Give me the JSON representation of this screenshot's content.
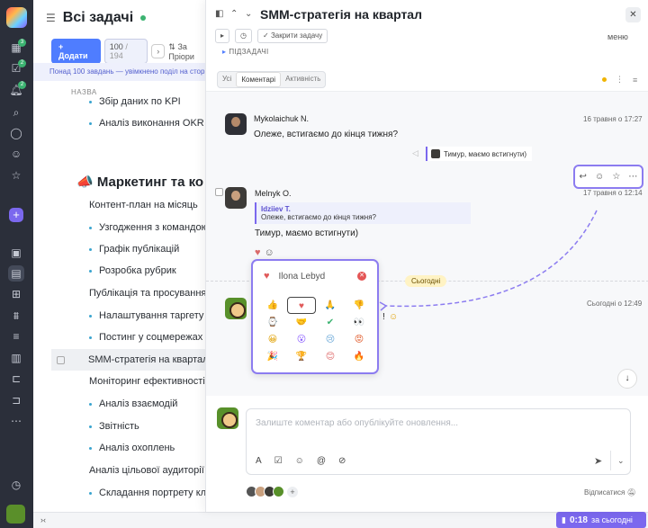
{
  "rail": {
    "badges": [
      "3",
      "2",
      "2"
    ]
  },
  "list": {
    "title": "Всі задачі",
    "add_label": "Додати",
    "pager_current": "100",
    "pager_total": "/ 194",
    "sort_label": "За Пріори",
    "notice": "Понад 100 завдань — увімкнено поділ на сторін",
    "column_name": "НАЗВА",
    "rows_top": [
      "Збір даних по KPI",
      "Аналіз виконання OKR"
    ],
    "section": "Маркетинг та ко",
    "rows": [
      {
        "text": "Контент-план на місяць",
        "bullet": false
      },
      {
        "text": "Узгодження з командою",
        "bullet": true
      },
      {
        "text": "Графік публікацій",
        "bullet": true
      },
      {
        "text": "Розробка рубрик",
        "bullet": true
      },
      {
        "text": "Публікація та просування",
        "bullet": false
      },
      {
        "text": "Налаштування таргету",
        "bullet": true
      },
      {
        "text": "Постинг у соцмережах",
        "bullet": true
      },
      {
        "text": "SMM-стратегія на квартал",
        "bullet": false,
        "selected": true
      },
      {
        "text": "Моніторинг ефективності",
        "bullet": false
      },
      {
        "text": "Аналіз взаємодій",
        "bullet": true
      },
      {
        "text": "Звітність",
        "bullet": true
      },
      {
        "text": "Аналіз охоплень",
        "bullet": true
      },
      {
        "text": "Аналіз цільової аудиторії",
        "bullet": false
      },
      {
        "text": "Складання портрету клієн",
        "bullet": true
      }
    ]
  },
  "panel": {
    "title": "SMM-стратегія на квартал",
    "close_task": "Закрити задачу",
    "menu": "меню",
    "subtasks": "ПІДЗАДАЧІ",
    "tabs": [
      "Усі",
      "Коментарі",
      "Активність"
    ],
    "comments": [
      {
        "author": "Mykolaichuk N.",
        "time": "16 травня о 17:27",
        "text": "Олеже, встигаємо до кінця тижня?"
      },
      {
        "author": "Melnyk O.",
        "time": "17 травня о 12:14",
        "quote_author": "Idziiev T.",
        "quote_text": "Олеже, встигаємо до кінця тижня?",
        "text": "Тимур, маємо встигнути)"
      },
      {
        "author": "",
        "time": "Сьогодні о 12:49",
        "text": "!"
      }
    ],
    "reply_tag": "Тимур, маємо встигнути)",
    "today": "Сьогодні",
    "emoji_popup": {
      "name": "Ilona Lebyd",
      "emojis": [
        "👍",
        "♥",
        "🙏",
        "👎",
        "⌚",
        "🤝",
        "✔",
        "👀",
        "😀",
        "😮",
        "😢",
        "😡",
        "🎉",
        "🏆",
        "😊",
        "🔥"
      ]
    },
    "composer_placeholder": "Залиште коментар або опублікуйте оновлення...",
    "subscribe": "Відписатися"
  },
  "timer": {
    "value": "0:18",
    "label": "за сьогодні"
  },
  "colors": {
    "accent": "#7b68ee",
    "primary": "#4f7dff",
    "rail": "#2b2f3a"
  }
}
